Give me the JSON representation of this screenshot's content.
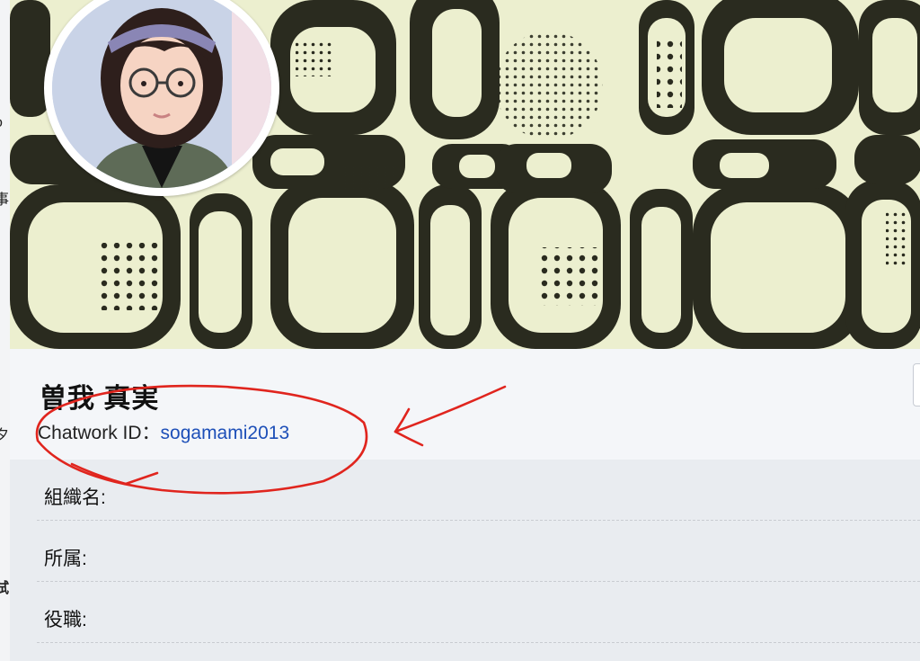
{
  "profile": {
    "name": "曽我 真実",
    "chatwork_id_label": "Chatwork ID：",
    "chatwork_id_value": "sogamami2013"
  },
  "details": {
    "fields": [
      {
        "label": "組織名:",
        "value": ""
      },
      {
        "label": "所属:",
        "value": ""
      },
      {
        "label": "役職:",
        "value": ""
      }
    ]
  },
  "left_strip_fragments": [
    "o",
    "事",
    "夕",
    "、",
    "試"
  ],
  "colors": {
    "cover_background": "#ecefcf",
    "cover_pattern": "#2a2b1f",
    "chatwork_id_link": "#1d4fb8",
    "annotation_ink": "#e0251e",
    "header_background": "#f4f6f9",
    "details_background": "#e9ecf0"
  },
  "icons": {
    "avatar": "illustrated-woman-with-glasses",
    "annotation": "red-circle-and-arrow"
  }
}
